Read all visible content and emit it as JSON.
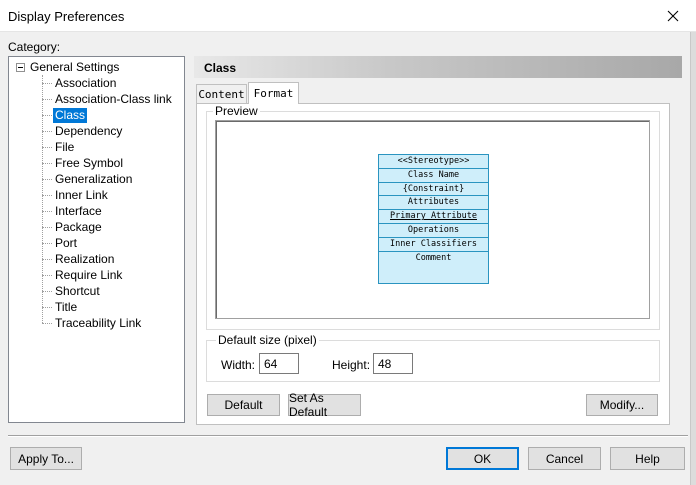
{
  "window": {
    "title": "Display Preferences",
    "close_glyph": "✕"
  },
  "category": {
    "label": "Category:",
    "root": "General Settings",
    "items": [
      "Association",
      "Association-Class link",
      "Class",
      "Dependency",
      "File",
      "Free Symbol",
      "Generalization",
      "Inner Link",
      "Interface",
      "Package",
      "Port",
      "Realization",
      "Require Link",
      "Shortcut",
      "Title",
      "Traceability Link"
    ],
    "selected": "Class"
  },
  "panel": {
    "header": "Class",
    "tabs": [
      {
        "label": "Content"
      },
      {
        "label": "Format"
      }
    ],
    "active_tab": "Format",
    "preview_label": "Preview",
    "class_symbol": {
      "rows": [
        "<<Stereotype>>",
        "Class Name",
        "{Constraint}",
        "Attributes",
        "Primary Attribute",
        "Operations",
        "Inner Classifiers",
        "Comment"
      ],
      "fill_color": "#cfeefa",
      "border_color": "#2a94c0"
    },
    "default_size": {
      "label": "Default size (pixel)",
      "width_label": "Width:",
      "width_value": "64",
      "height_label": "Height:",
      "height_value": "48"
    },
    "buttons": {
      "default": "Default",
      "set_as_default": "Set As Default",
      "modify": "Modify..."
    }
  },
  "footer": {
    "apply_to": "Apply To...",
    "ok": "OK",
    "cancel": "Cancel",
    "help": "Help"
  },
  "colors": {
    "selection": "#0078d7"
  }
}
